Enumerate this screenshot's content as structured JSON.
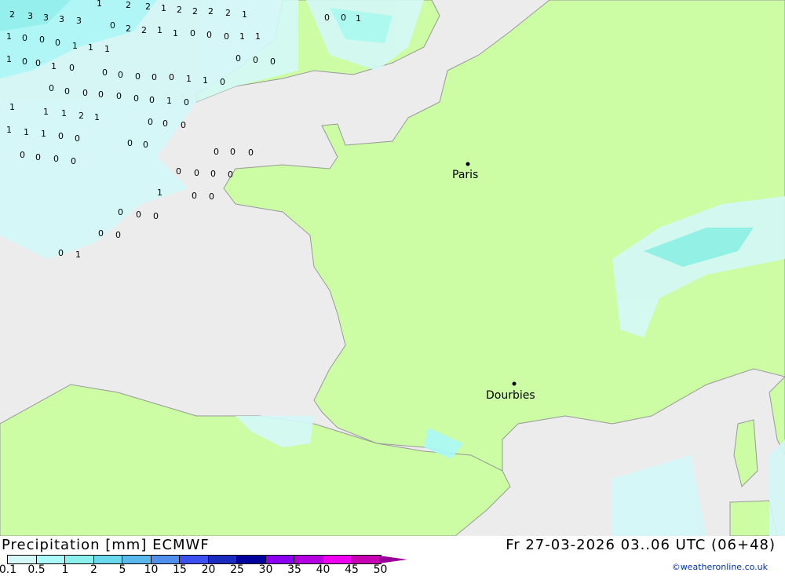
{
  "legend": {
    "title": "Precipitation [mm] ECMWF",
    "ticks": [
      "0.1",
      "0.5",
      "1",
      "2",
      "5",
      "10",
      "15",
      "20",
      "25",
      "30",
      "35",
      "40",
      "45",
      "50"
    ],
    "colors": [
      "#d4f8f8",
      "#aaf8f8",
      "#8cf0ec",
      "#6ad8ec",
      "#5ab8ec",
      "#5090ec",
      "#3c50f0",
      "#1a2cc0",
      "#00009c",
      "#8c00f0",
      "#b400e0",
      "#f000f0",
      "#c800b4"
    ]
  },
  "date_label": "Fr 27-03-2026 03..06 UTC (06+48)",
  "copyright": "©weatheronline.co.uk",
  "cities": [
    {
      "name": "Paris"
    },
    {
      "name": "Dourbies"
    }
  ],
  "map_values": [
    "2",
    "3",
    "3",
    "3",
    "3",
    "1",
    "2",
    "2",
    "1",
    "2",
    "2",
    "2",
    "2",
    "1",
    "1",
    "0",
    "0",
    "0",
    "1",
    "1",
    "1",
    "0",
    "2",
    "2",
    "1",
    "1",
    "0",
    "0",
    "0",
    "1",
    "1",
    "1",
    "0",
    "0",
    "1",
    "0",
    "0",
    "0",
    "0",
    "0",
    "0",
    "1",
    "1",
    "0",
    "0",
    "0",
    "0",
    "0",
    "0",
    "0",
    "0",
    "0",
    "0",
    "0",
    "1",
    "0",
    "1",
    "1",
    "1",
    "2",
    "1",
    "0",
    "0",
    "0",
    "1",
    "1",
    "1",
    "0",
    "0",
    "0",
    "0",
    "0",
    "0",
    "0",
    "0",
    "0",
    "0",
    "0",
    "0",
    "0",
    "0",
    "0",
    "1",
    "0",
    "0",
    "0",
    "0",
    "0",
    "0",
    "0",
    "0",
    "1",
    "0",
    "0",
    "1"
  ],
  "colors": {
    "sea": "#ececec",
    "land": "#ccfca4",
    "border": "#999999"
  }
}
